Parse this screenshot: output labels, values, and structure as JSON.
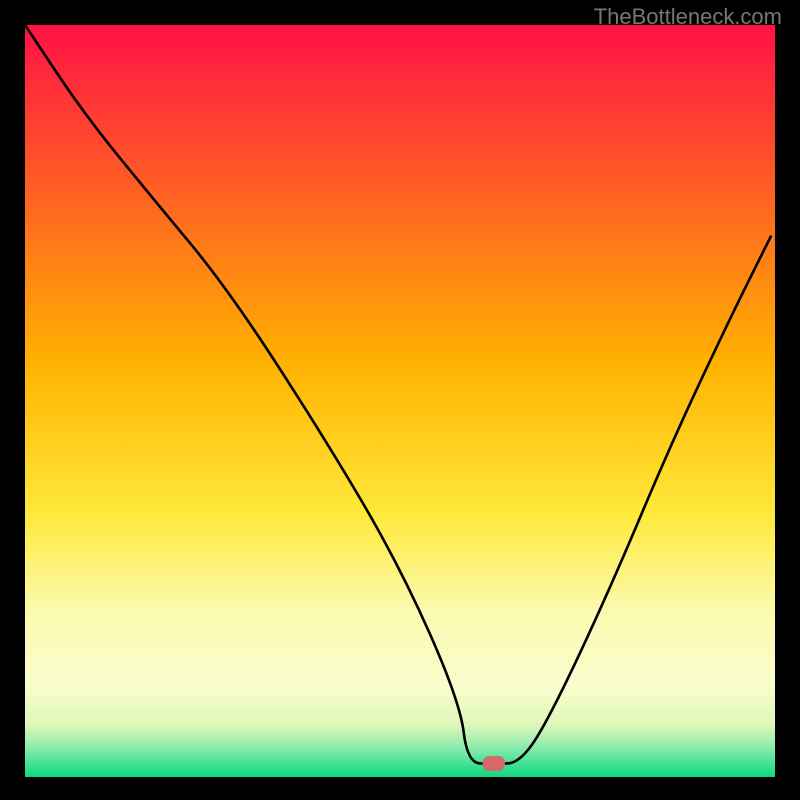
{
  "watermark": "TheBottleneck.com",
  "chart_data": {
    "type": "line",
    "title": "",
    "xlabel": "",
    "ylabel": "",
    "xlim": [
      0,
      100
    ],
    "ylim": [
      0,
      100
    ],
    "gradient_stops": [
      {
        "offset": 0,
        "color": "#ff1145"
      },
      {
        "offset": 0.45,
        "color": "#ffb200"
      },
      {
        "offset": 0.65,
        "color": "#ffe93a"
      },
      {
        "offset": 0.78,
        "color": "#fbfab0"
      },
      {
        "offset": 0.88,
        "color": "#f9fdce"
      },
      {
        "offset": 0.93,
        "color": "#dff7b8"
      },
      {
        "offset": 0.96,
        "color": "#8eecae"
      },
      {
        "offset": 1.0,
        "color": "#0cd880"
      }
    ],
    "series": [
      {
        "name": "bottleneck-curve",
        "color": "#000000",
        "x": [
          0,
          8,
          17,
          27,
          40,
          50,
          58,
          59,
          62.5,
          66,
          70,
          78,
          86,
          94,
          99.5
        ],
        "y": [
          100,
          88,
          77,
          65,
          45,
          28,
          10,
          1.8,
          1.8,
          1.8,
          8,
          25,
          44,
          61,
          72
        ]
      }
    ],
    "marker": {
      "name": "current-point",
      "x": 62.5,
      "y": 1.8,
      "width": 3.0,
      "height": 2.0,
      "color": "#d46a6a"
    }
  }
}
